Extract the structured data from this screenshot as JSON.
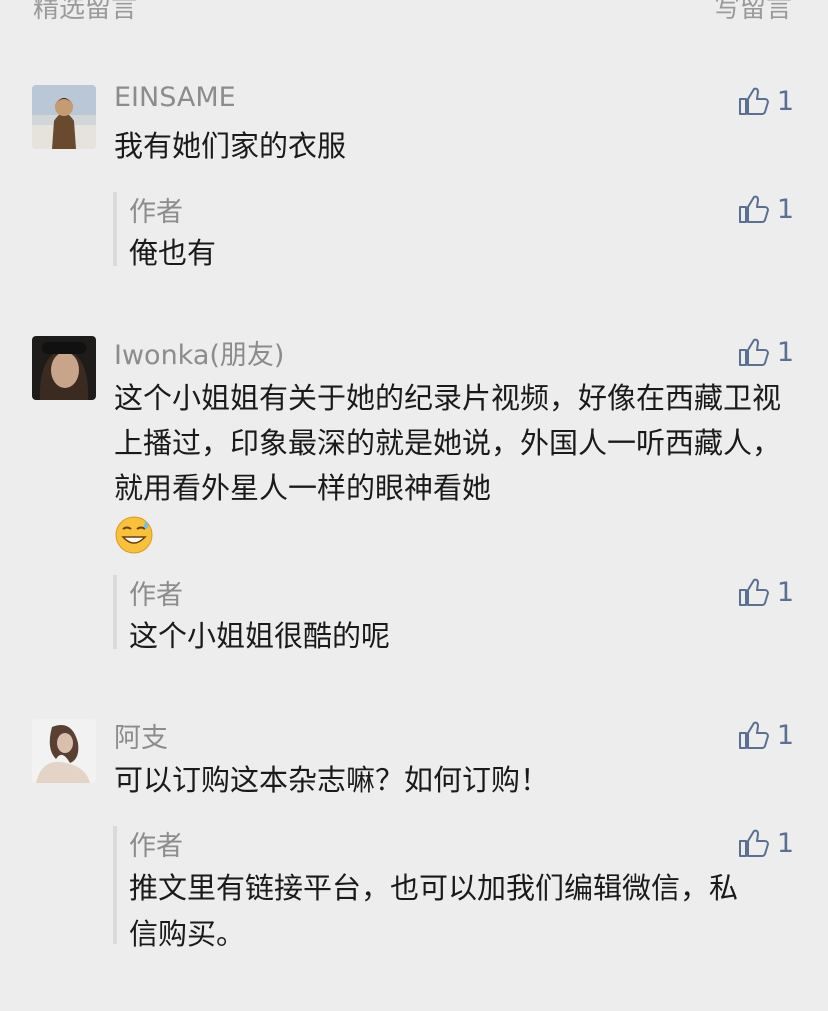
{
  "header": {
    "left_label": "精选留言",
    "right_label": "写留言"
  },
  "comments": [
    {
      "nickname": "EINSAME",
      "text": "我有她们家的衣服",
      "likes": "1",
      "reply": {
        "author": "作者",
        "text": "俺也有",
        "likes": "1"
      }
    },
    {
      "nickname": "Iwonka(朋友)",
      "text": "这个小姐姐有关于她的纪录片视频，好像在西藏卫视上播过，印象最深的就是她说，外国人一听西藏人，就用看外星人一样的眼神看她",
      "emoji": "sweat-smile-emoji",
      "likes": "1",
      "reply": {
        "author": "作者",
        "text": "这个小姐姐很酷的呢",
        "likes": "1"
      }
    },
    {
      "nickname": "阿支",
      "text": "可以订购这本杂志嘛？如何订购！",
      "likes": "1",
      "reply": {
        "author": "作者",
        "text": "推文里有链接平台，也可以加我们编辑微信，私信购买。",
        "likes": "1"
      }
    }
  ],
  "colors": {
    "background": "#ededed",
    "like_icon": "#5a6f92",
    "meta_text": "#8c8c8c"
  }
}
